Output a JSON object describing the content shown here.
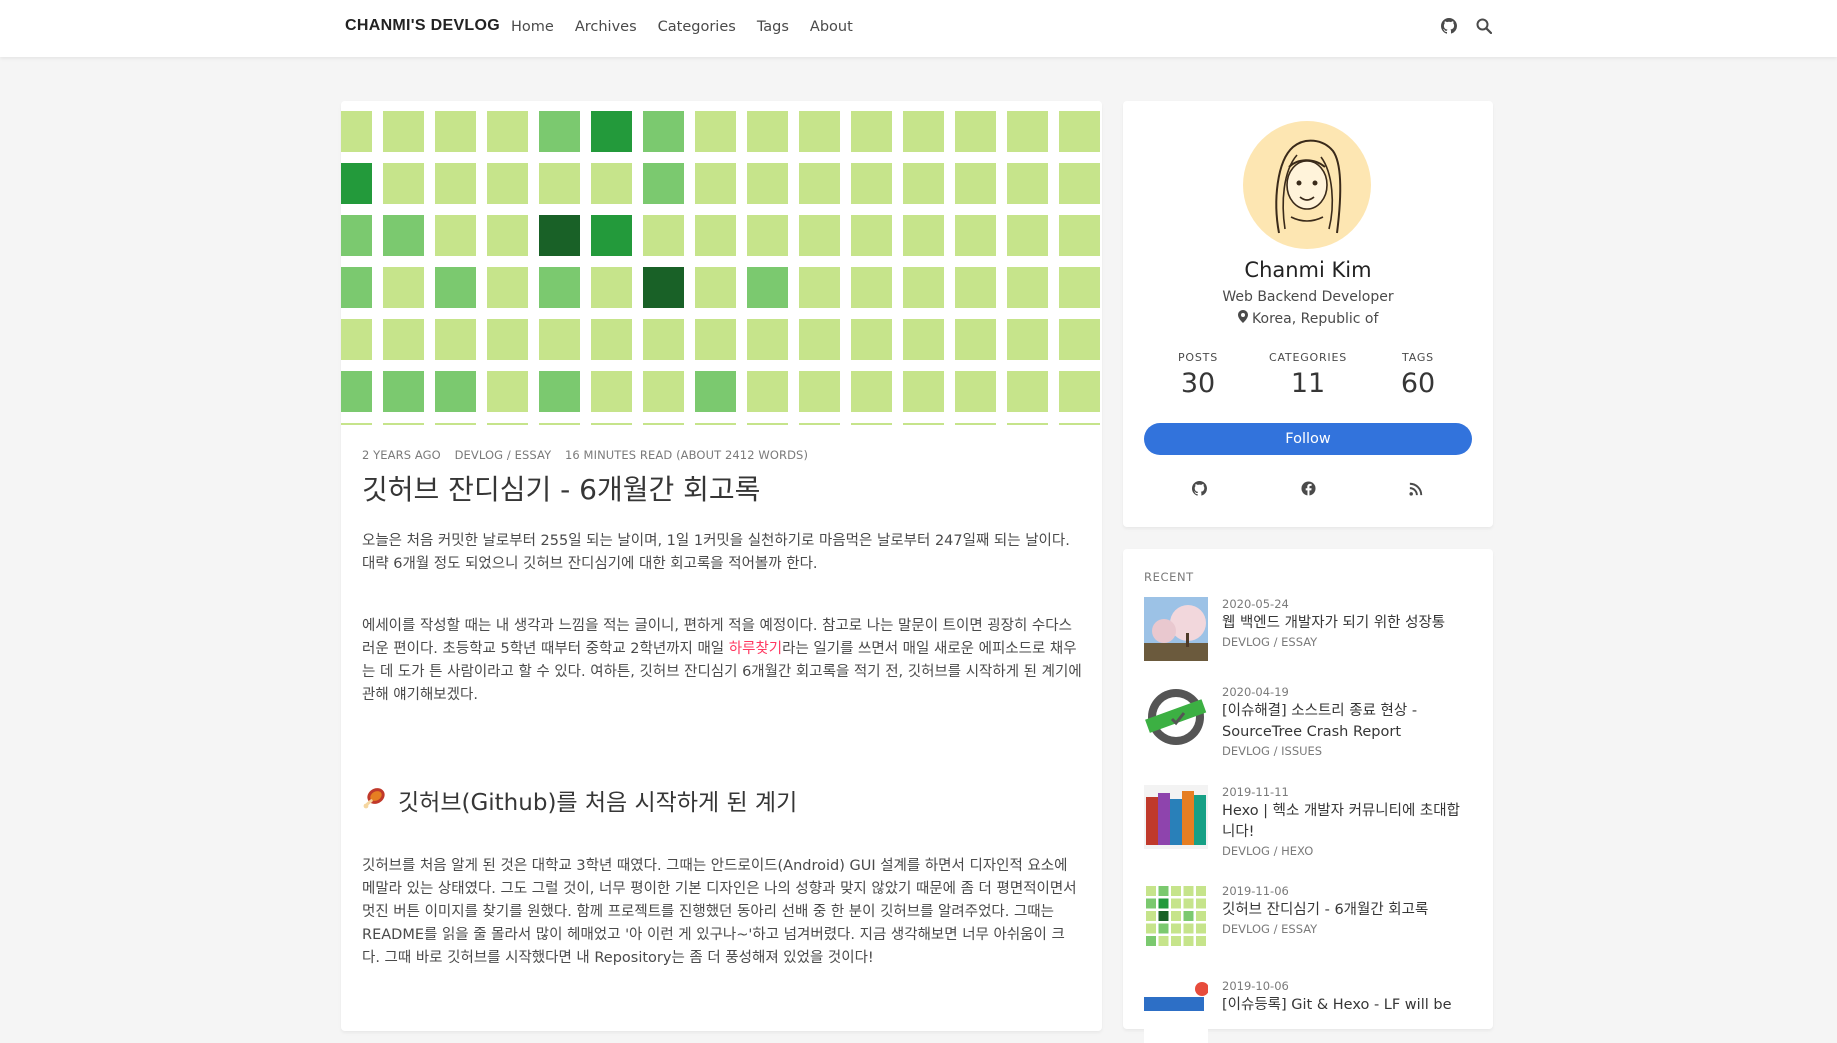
{
  "nav": {
    "brand": "CHANMI'S DEVLOG",
    "links": [
      "Home",
      "Archives",
      "Categories",
      "Tags",
      "About"
    ],
    "icons": [
      "github-icon",
      "search-icon"
    ]
  },
  "post": {
    "meta": {
      "time": "2 YEARS AGO",
      "category": "DEVLOG / ESSAY",
      "read": "16 MINUTES READ (ABOUT 2412 WORDS)"
    },
    "title": "깃허브 잔디심기 - 6개월간 회고록",
    "p1": "오늘은 처음 커밋한 날로부터 255일 되는 날이며, 1일 1커밋을 실천하기로 마음먹은 날로부터 247일째 되는 날이다. 대략 6개월 정도 되었으니 깃허브 잔디심기에 대한 회고록을 적어볼까 한다.",
    "p2_before": "에세이를 작성할 때는 내 생각과 느낌을 적는 글이니, 편하게 적을 예정이다. 참고로 나는 말문이 트이면 굉장히 수다스러운 편이다. 초등학교 5학년 때부터 중학교 2학년까지 매일 ",
    "p2_link": "하루찾기",
    "p2_after": "라는 일기를 쓰면서 매일 새로운 에피소드로 채우는 데 도가 튼 사람이라고 할 수 있다. 여하튼, 깃허브 잔디심기 6개월간 회고록을 적기 전, 깃허브를 시작하게 된 계기에 관해 얘기해보겠다.",
    "h2": "깃허브(Github)를 처음 시작하게 된 계기",
    "p3": "깃허브를 처음 알게 된 것은 대학교 3학년 때였다. 그때는 안드로이드(Android) GUI 설계를 하면서 디자인적 요소에 메말라 있는 상태였다. 그도 그럴 것이, 너무 평이한 기본 디자인은 나의 성향과 맞지 않았기 때문에 좀 더 평면적이면서 멋진 버튼 이미지를 찾기를 원했다. 함께 프로젝트를 진행했던 동아리 선배 중 한 분이 깃허브를 알려주었다. 그때는 README를 읽을 줄 몰라서 많이 헤매었고 '아 이런 게 있구나~'하고 넘겨버렸다. 지금 생각해보면 너무 아쉬움이 크다. 그때 바로 깃허브를 시작했다면 내 Repository는 좀 더 풍성해져 있었을 것이다!"
  },
  "profile": {
    "name": "Chanmi Kim",
    "title": "Web Backend Developer",
    "location": "Korea, Republic of",
    "stats": [
      {
        "label": "POSTS",
        "value": "30"
      },
      {
        "label": "CATEGORIES",
        "value": "11"
      },
      {
        "label": "TAGS",
        "value": "60"
      }
    ],
    "follow": "Follow",
    "social_icons": [
      "github-icon",
      "facebook-icon",
      "rss-icon"
    ]
  },
  "recent": {
    "heading": "RECENT",
    "items": [
      {
        "date": "2020-05-24",
        "title": "웹 백엔드 개발자가 되기 위한 성장통",
        "category": "DEVLOG / ESSAY"
      },
      {
        "date": "2020-04-19",
        "title": "[이슈해결] 소스트리 종료 현상 - SourceTree Crash Report",
        "category": "DEVLOG / ISSUES"
      },
      {
        "date": "2019-11-11",
        "title": "Hexo | 헥소 개발자 커뮤니티에 초대합니다!",
        "category": "DEVLOG / HEXO"
      },
      {
        "date": "2019-11-06",
        "title": "깃허브 잔디심기 - 6개월간 회고록",
        "category": "DEVLOG / ESSAY"
      },
      {
        "date": "2019-10-06",
        "title": "[이슈등록] Git & Hexo - LF will be",
        "category": ""
      }
    ]
  },
  "colors": {
    "accent": "#3273dc",
    "link": "#ff3860",
    "grass": [
      "#c6e48b",
      "#7bc96f",
      "#239a3b",
      "#196127"
    ]
  }
}
